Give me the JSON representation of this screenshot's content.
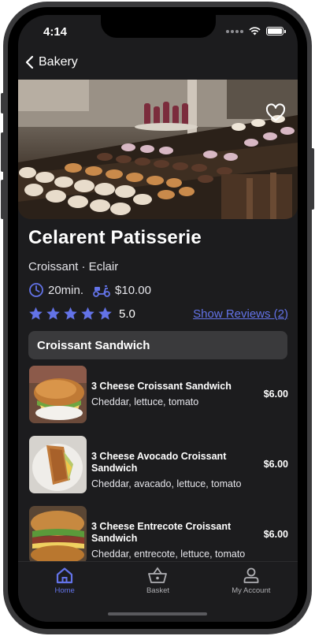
{
  "status_bar": {
    "time": "4:14"
  },
  "nav": {
    "back_label": "Bakery"
  },
  "store": {
    "name": "Celarent Patisserie",
    "categories": "Croissant · Eclair",
    "delivery_time": "20min.",
    "delivery_fee": "$10.00",
    "rating": "5.0",
    "rating_stars": 5,
    "reviews_link": "Show Reviews (2)"
  },
  "section": {
    "title": "Croissant Sandwich"
  },
  "menu": [
    {
      "name": "3 Cheese Croissant Sandwich",
      "desc": "Cheddar, lettuce, tomato",
      "price": "$6.00"
    },
    {
      "name": "3 Cheese Avocado Croissant Sandwich",
      "desc": "Cheddar, avacado, lettuce, tomato",
      "price": "$6.00"
    },
    {
      "name": "3 Cheese Entrecote Croissant Sandwich",
      "desc": "Cheddar, entrecote, lettuce, tomato",
      "price": "$6.00"
    }
  ],
  "tabs": [
    {
      "label": "Home",
      "icon": "home-icon",
      "active": true
    },
    {
      "label": "Basket",
      "icon": "basket-icon",
      "active": false
    },
    {
      "label": "My Account",
      "icon": "account-icon",
      "active": false
    }
  ],
  "colors": {
    "accent": "#6373e8",
    "background": "#1c1c1e",
    "section_bg": "#3a3a3c"
  }
}
